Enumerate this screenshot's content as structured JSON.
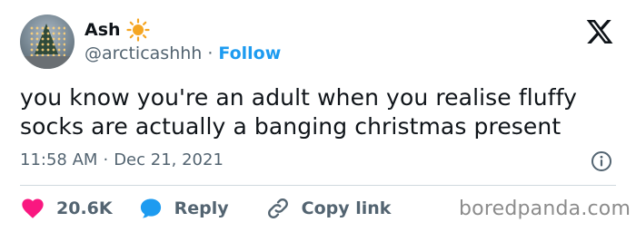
{
  "author": {
    "name": "Ash",
    "emoji_icon": "sun-icon",
    "handle": "@arcticashhh",
    "separator": "·",
    "follow_label": "Follow"
  },
  "tweet": {
    "text_line1": "you know you're an adult when you realise fluffy",
    "text_line2": "socks are actually a banging christmas present",
    "time": "11:58 AM",
    "meta_separator": "·",
    "date": "Dec 21, 2021"
  },
  "actions": {
    "likes_count": "20.6K",
    "reply_label": "Reply",
    "copy_link_label": "Copy link"
  },
  "watermark": "boredpanda.com",
  "colors": {
    "accent": "#1d9bf0",
    "like": "#f91880",
    "text": "#0f1419",
    "muted": "#536471",
    "sun": "#f5a623"
  }
}
